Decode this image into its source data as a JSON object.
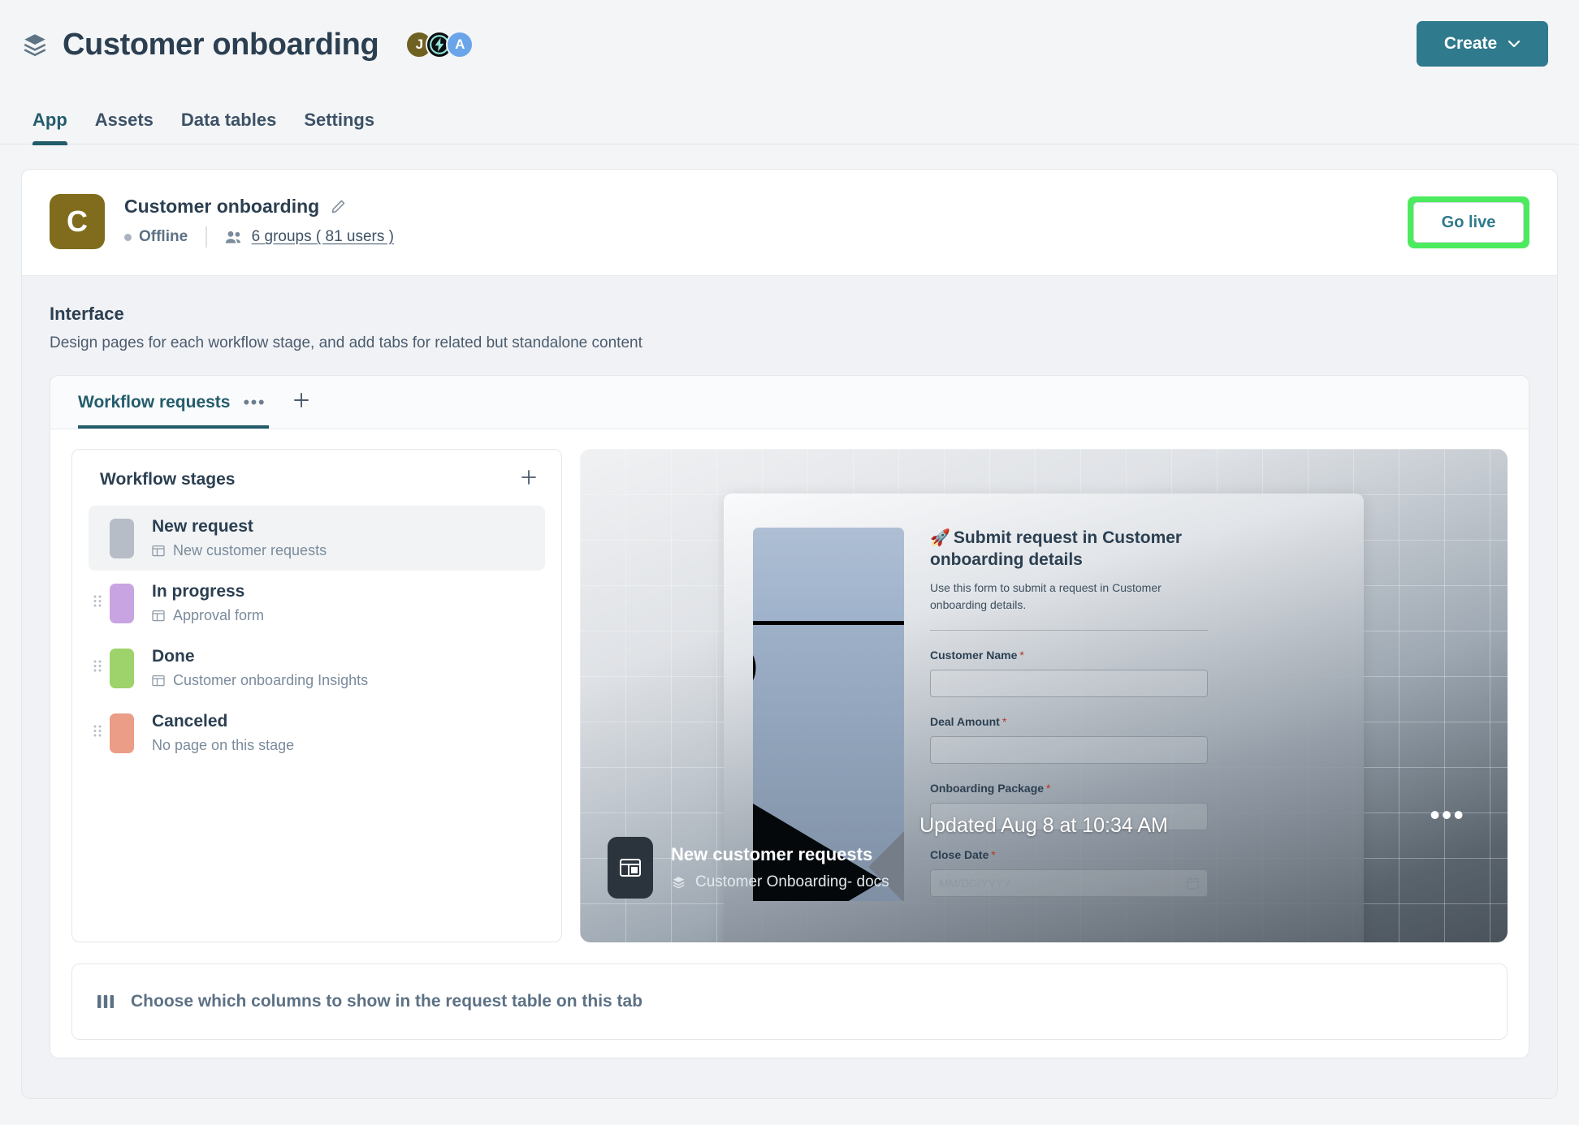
{
  "header": {
    "logo_icon": "layers-icon",
    "title": "Customer onboarding",
    "avatars": [
      {
        "label": "J",
        "kind": "letter",
        "color": "#6f6121"
      },
      {
        "label": "",
        "kind": "bolt-icon",
        "color": "#0b0f12"
      },
      {
        "label": "A",
        "kind": "letter",
        "color": "#6aa5ea"
      }
    ],
    "create_label": "Create",
    "create_color": "#2f7a8c",
    "chevron_icon": "chevron-down-icon"
  },
  "nav": {
    "tabs": [
      {
        "label": "App",
        "active": true
      },
      {
        "label": "Assets",
        "active": false
      },
      {
        "label": "Data tables",
        "active": false
      },
      {
        "label": "Settings",
        "active": false
      }
    ]
  },
  "app_header": {
    "avatar_letter": "C",
    "avatar_color": "#806c1c",
    "name": "Customer onboarding",
    "edit_icon": "pencil-icon",
    "status": "Offline",
    "status_dot_color": "#aab4c0",
    "people_icon": "people-icon",
    "groups_link": "6 groups ( 81 users )",
    "go_live_label": "Go live",
    "go_live_highlight_color": "#4ceb5e"
  },
  "interface": {
    "title": "Interface",
    "subtitle": "Design pages for each workflow stage, and add tabs for related but standalone content",
    "tab": {
      "label": "Workflow requests",
      "more_icon": "ellipsis-icon",
      "add_icon": "plus-icon"
    }
  },
  "stages": {
    "title": "Workflow stages",
    "add_icon": "plus-icon",
    "items": [
      {
        "name": "New request",
        "page": "New customer requests",
        "color": "#b6bdc6",
        "has_page": true,
        "selected": true,
        "draggable": false
      },
      {
        "name": "In progress",
        "page": "Approval form",
        "color": "#c9a4e2",
        "has_page": true,
        "selected": false,
        "draggable": true
      },
      {
        "name": "Done",
        "page": "Customer onboarding Insights",
        "color": "#9dd36a",
        "has_page": true,
        "selected": false,
        "draggable": true
      },
      {
        "name": "Canceled",
        "page": "No page on this stage",
        "color": "#eb9d87",
        "has_page": false,
        "selected": false,
        "draggable": true
      }
    ]
  },
  "preview": {
    "form": {
      "rocket": "🚀",
      "title": "Submit request in Customer onboarding details",
      "description": "Use this form to submit a request in Customer onboarding details.",
      "fields": [
        {
          "label": "Customer Name",
          "required": true,
          "placeholder": "",
          "icon": ""
        },
        {
          "label": "Deal Amount",
          "required": true,
          "placeholder": "",
          "icon": ""
        },
        {
          "label": "Onboarding Package",
          "required": true,
          "placeholder": "",
          "icon": ""
        },
        {
          "label": "Close Date",
          "required": true,
          "placeholder": "MM/DD/YYYY",
          "icon": "calendar-icon"
        }
      ]
    },
    "updated_label": "Updated Aug 8 at 10:34 AM",
    "more_icon": "ellipsis-icon",
    "footer": {
      "page_icon": "page-layout-icon",
      "name": "New customer requests",
      "source_icon": "layers-icon",
      "source": "Customer Onboarding- docs"
    }
  },
  "columns_bar": {
    "icon": "columns-icon",
    "label": "Choose which columns to show in the request table on this tab"
  }
}
